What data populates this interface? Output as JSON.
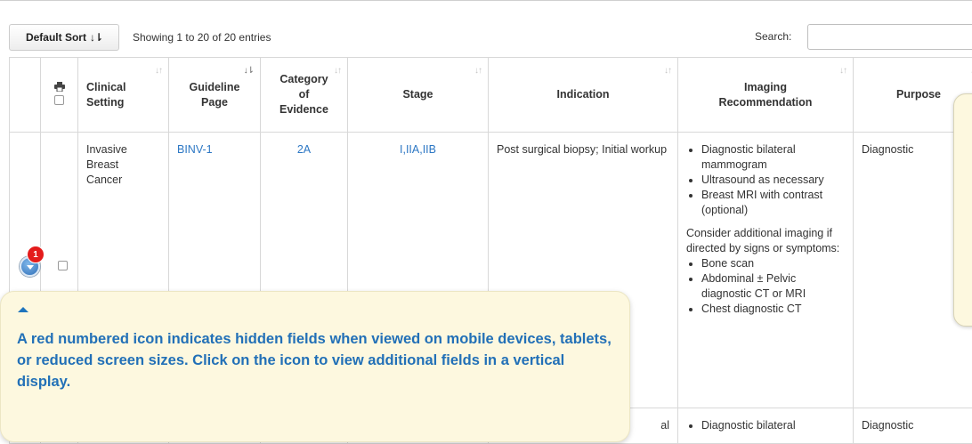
{
  "toolbar": {
    "sort_label": "Default Sort",
    "showing": "Showing 1 to 20 of 20 entries",
    "search_label": "Search:",
    "search_value": ""
  },
  "columns": {
    "clinical_setting": "Clinical Setting",
    "guideline_page": "Guideline Page",
    "category": "Category of Evidence",
    "stage": "Stage",
    "indication": "Indication",
    "imaging": "Imaging Recommendation",
    "purpose": "Purpose"
  },
  "rows": [
    {
      "clinical_setting": "Invasive Breast Cancer",
      "guideline_page": "BINV-1",
      "category": "2A",
      "stage": "I,IIA,IIB",
      "indication": "Post surgical biopsy; Initial workup",
      "imaging_items": [
        "Diagnostic bilateral mammogram",
        "Ultrasound as necessary",
        "Breast MRI with contrast (optional)"
      ],
      "imaging_note": "Consider additional imaging if directed by signs or symptoms:",
      "imaging_items2": [
        "Bone scan",
        "Abdominal ± Pelvic diagnostic CT or MRI",
        "Chest diagnostic CT"
      ],
      "purpose": "Diagnostic",
      "hidden_count": "1"
    },
    {
      "indication_partial": "al",
      "imaging_partial": "Diagnostic bilateral",
      "purpose": "Diagnostic"
    }
  ],
  "callout": {
    "text": "A red numbered icon indicates hidden fields when viewed on mobile devices, tablets, or reduced screen sizes. Click on the icon to view additional fields in a vertical display."
  },
  "colors": {
    "link": "#2c77c4",
    "callout_bg": "#fdf8df",
    "callout_text": "#2270b7",
    "badge": "#e41b1b"
  }
}
